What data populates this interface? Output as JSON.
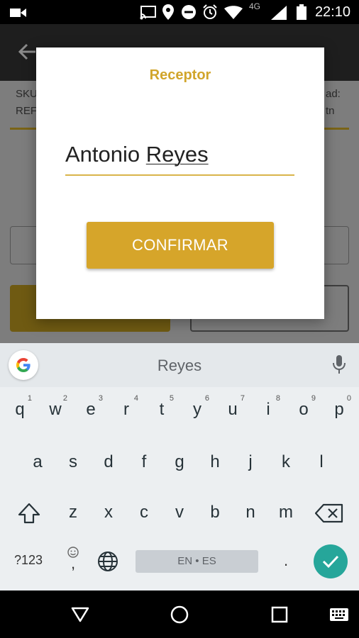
{
  "status_bar": {
    "time": "22:10",
    "network": "4G",
    "icons": [
      "video-icon",
      "cast-icon",
      "location-icon",
      "dnd-icon",
      "alarm-icon",
      "wifi-icon",
      "signal-icon",
      "battery-icon"
    ]
  },
  "dialog": {
    "title": "Receptor",
    "input_value_first": "Antonio ",
    "input_value_second": "Reyes",
    "confirm_label": "CONFIRMAR"
  },
  "background_app": {
    "left_label_1": "SKU",
    "left_label_2": "REF",
    "right_label_1": "ad:",
    "right_label_2": "tn"
  },
  "keyboard": {
    "suggestion": "Reyes",
    "row1": [
      {
        "ch": "q",
        "hint": "1"
      },
      {
        "ch": "w",
        "hint": "2"
      },
      {
        "ch": "e",
        "hint": "3"
      },
      {
        "ch": "r",
        "hint": "4"
      },
      {
        "ch": "t",
        "hint": "5"
      },
      {
        "ch": "y",
        "hint": "6"
      },
      {
        "ch": "u",
        "hint": "7"
      },
      {
        "ch": "i",
        "hint": "8"
      },
      {
        "ch": "o",
        "hint": "9"
      },
      {
        "ch": "p",
        "hint": "0"
      }
    ],
    "row2": [
      "a",
      "s",
      "d",
      "f",
      "g",
      "h",
      "j",
      "k",
      "l"
    ],
    "row3": [
      "z",
      "x",
      "c",
      "v",
      "b",
      "n",
      "m"
    ],
    "symbols_label": "?123",
    "comma": ",",
    "space_label": "EN • ES",
    "period": "."
  },
  "colors": {
    "accent": "#d6a52a",
    "title": "#d1a52b",
    "enter": "#26a69a"
  }
}
